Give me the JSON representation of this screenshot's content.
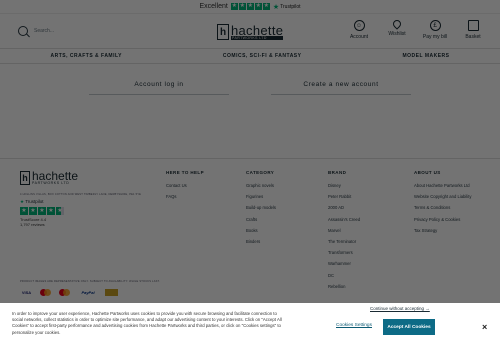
{
  "topbar": {
    "excellent": "Excellent",
    "trustpilot": "Trustpilot"
  },
  "search": {
    "placeholder": "Search..."
  },
  "logo": {
    "main": "hachette",
    "sub": "PARTWORKS LTD"
  },
  "actions": [
    {
      "label": "Account",
      "icon": "user-icon"
    },
    {
      "label": "Wishlist",
      "icon": "heart-icon"
    },
    {
      "label": "Pay my bill",
      "icon": "pound-icon"
    },
    {
      "label": "Basket",
      "icon": "basket-icon"
    }
  ],
  "nav": [
    "ARTS, CRAFTS & FAMILY",
    "COMICS, SCI-FI & FANTASY",
    "MODEL MAKERS"
  ],
  "account": {
    "login": "Account log in",
    "create": "Create a new account"
  },
  "footer": {
    "address": "4 HOLLINS VILLAS, BOX COTTON AND WEST TIMBERLY LANE, DERBYSHIRE, PE1 5YE",
    "trustpilot": {
      "label": "Trustpilot",
      "score": "TrustScore 4.4",
      "reviews": "1,797 reviews"
    },
    "columns": [
      {
        "title": "HERE TO HELP",
        "items": [
          "Contact Us",
          "FAQs"
        ]
      },
      {
        "title": "CATEGORY",
        "items": [
          "Graphic novels",
          "Figurines",
          "Build-up models",
          "Crafts",
          "Books",
          "Binders"
        ]
      },
      {
        "title": "BRAND",
        "items": [
          "Disney",
          "Peter Rabbit",
          "2000 AD",
          "Assassin's Creed",
          "Marvel",
          "The Terminator",
          "Transformers",
          "Warhammer",
          "DC",
          "Rebellion"
        ]
      },
      {
        "title": "ABOUT US",
        "items": [
          "About Hachette Partworks Ltd",
          "Website Copyright and Liability",
          "Terms & Conditions",
          "Privacy Policy & Cookies",
          "Tax Strategy"
        ]
      }
    ],
    "legal": "PRODUCT IMAGES ARE REPRESENTATIVE ONLY. SUBJECT TO AVAILABILITY. WHILE STOCKS LAST.",
    "payments": [
      "VISA",
      "mastercard",
      "maestro",
      "PayPal",
      "amex"
    ]
  },
  "cookie": {
    "text": "In order to improve your user experience, Hachette Partworks uses cookies to provide you with secure browsing and facilitate connection to social networks, collect statistics in order to optimize site performance, and adapt our advertising content to your interests. Click on \"Accept All Cookies\" to accept first-party performance and advertising cookies from Hachette Partworks and third parties, or click on \"Cookies settings\" to personalize your cookies.",
    "more": "Continue without accepting →",
    "settings": "Cookies Settings",
    "accept": "Accept All Cookies",
    "close": "×"
  },
  "colors": {
    "trustpilot": "#00b67a",
    "accept": "#0d6b86",
    "brand": "#1a2a33"
  }
}
